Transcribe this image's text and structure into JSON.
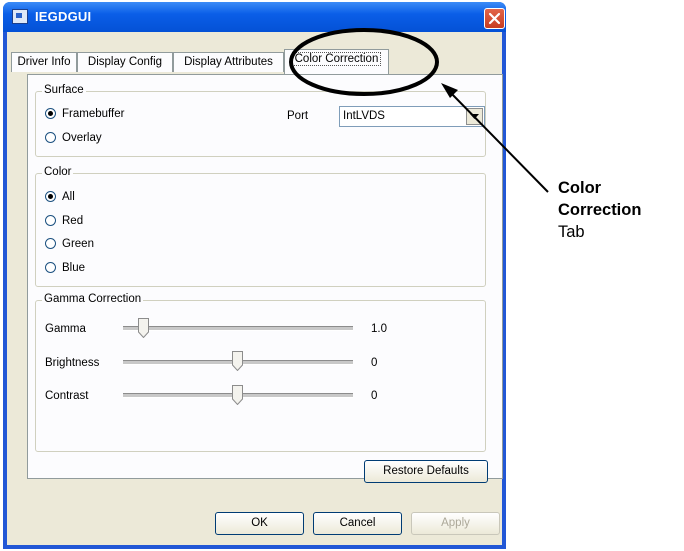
{
  "window": {
    "title": "IEGDGUI"
  },
  "tabs": [
    {
      "label": "Driver Info"
    },
    {
      "label": "Display Config"
    },
    {
      "label": "Display Attributes"
    },
    {
      "label": "Color Correction"
    }
  ],
  "surface": {
    "legend": "Surface",
    "options": [
      {
        "label": "Framebuffer",
        "selected": true
      },
      {
        "label": "Overlay",
        "selected": false
      }
    ],
    "port_label": "Port",
    "port_value": "IntLVDS"
  },
  "color": {
    "legend": "Color",
    "options": [
      {
        "label": "All",
        "selected": true
      },
      {
        "label": "Red",
        "selected": false
      },
      {
        "label": "Green",
        "selected": false
      },
      {
        "label": "Blue",
        "selected": false
      }
    ]
  },
  "gamma": {
    "legend": "Gamma Correction",
    "sliders": [
      {
        "label": "Gamma",
        "value": "1.0"
      },
      {
        "label": "Brightness",
        "value": "0"
      },
      {
        "label": "Contrast",
        "value": "0"
      }
    ],
    "restore_label": "Restore Defaults"
  },
  "footer": {
    "ok_label": "OK",
    "cancel_label": "Cancel",
    "apply_label": "Apply"
  },
  "annotation": {
    "line1": "Color",
    "line2": "Correction",
    "line3": "Tab"
  },
  "icons": {
    "app": "window-app-icon",
    "close": "close-icon",
    "dropdown": "chevron-down-icon"
  }
}
